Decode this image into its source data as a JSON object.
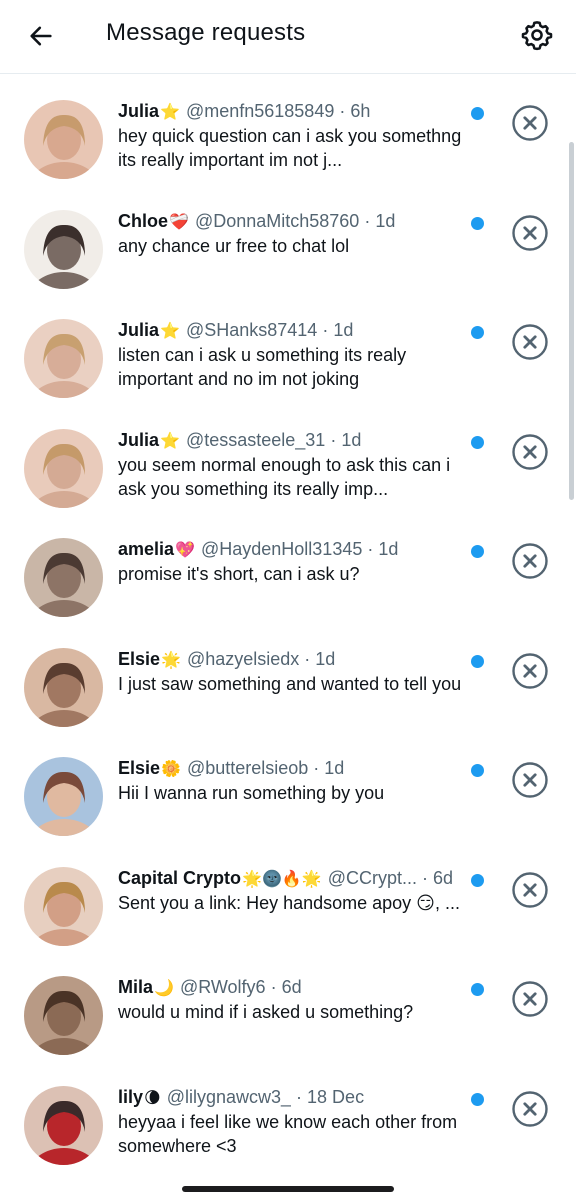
{
  "header": {
    "title": "Message requests",
    "back_icon": "arrow-left-icon",
    "settings_icon": "gear-icon"
  },
  "colors": {
    "accent": "#1d9bf0",
    "secondary_text": "#536471",
    "dismiss": "#536471"
  },
  "requests": [
    {
      "name": "Julia",
      "emoji": "⭐",
      "handle": "@menfn56185849",
      "time": "6h",
      "preview": "hey quick question can i ask you somethng its really important im not j...",
      "unread": true
    },
    {
      "name": "Chloe",
      "emoji": "❤️‍🩹",
      "handle": "@DonnaMitch58760",
      "time": "1d",
      "preview": "any chance ur free to chat lol",
      "unread": true
    },
    {
      "name": "Julia",
      "emoji": "⭐",
      "handle": "@SHanks87414",
      "time": "1d",
      "preview": "listen can i ask u something its realy important and no im not joking",
      "unread": true
    },
    {
      "name": "Julia",
      "emoji": "⭐",
      "handle": "@tessasteele_31",
      "time": "1d",
      "preview": "you seem normal enough to ask this can i ask you something its really imp...",
      "unread": true
    },
    {
      "name": "amelia",
      "emoji": "💖",
      "handle": "@HaydenHoll31345",
      "time": "1d",
      "preview": "promise it's short, can i ask u?",
      "unread": true
    },
    {
      "name": "Elsie",
      "emoji": "🌟",
      "handle": "@hazyelsiedx",
      "time": "1d",
      "preview": "I just saw something and wanted to tell you",
      "unread": true
    },
    {
      "name": "Elsie",
      "emoji": "🌼",
      "handle": "@butterelsieob",
      "time": "1d",
      "preview": "Hii I wanna run something by you",
      "unread": true
    },
    {
      "name": "Capital Crypto",
      "emoji": "🌟🌚🔥🌟",
      "handle": "@CCrypt...",
      "time": "6d",
      "preview": "Sent you a link: Hey handsome apoy 😏, ...",
      "unread": true
    },
    {
      "name": "Mila",
      "emoji": "🌙",
      "handle": "@RWolfy6",
      "time": "6d",
      "preview": "would u mind if i asked u something?",
      "unread": true
    },
    {
      "name": "lily",
      "emoji": "🌘",
      "handle": "@lilygnawcw3_",
      "time": "18 Dec",
      "preview": "heyyaa i feel like we know each other from somewhere <3",
      "unread": true
    }
  ]
}
